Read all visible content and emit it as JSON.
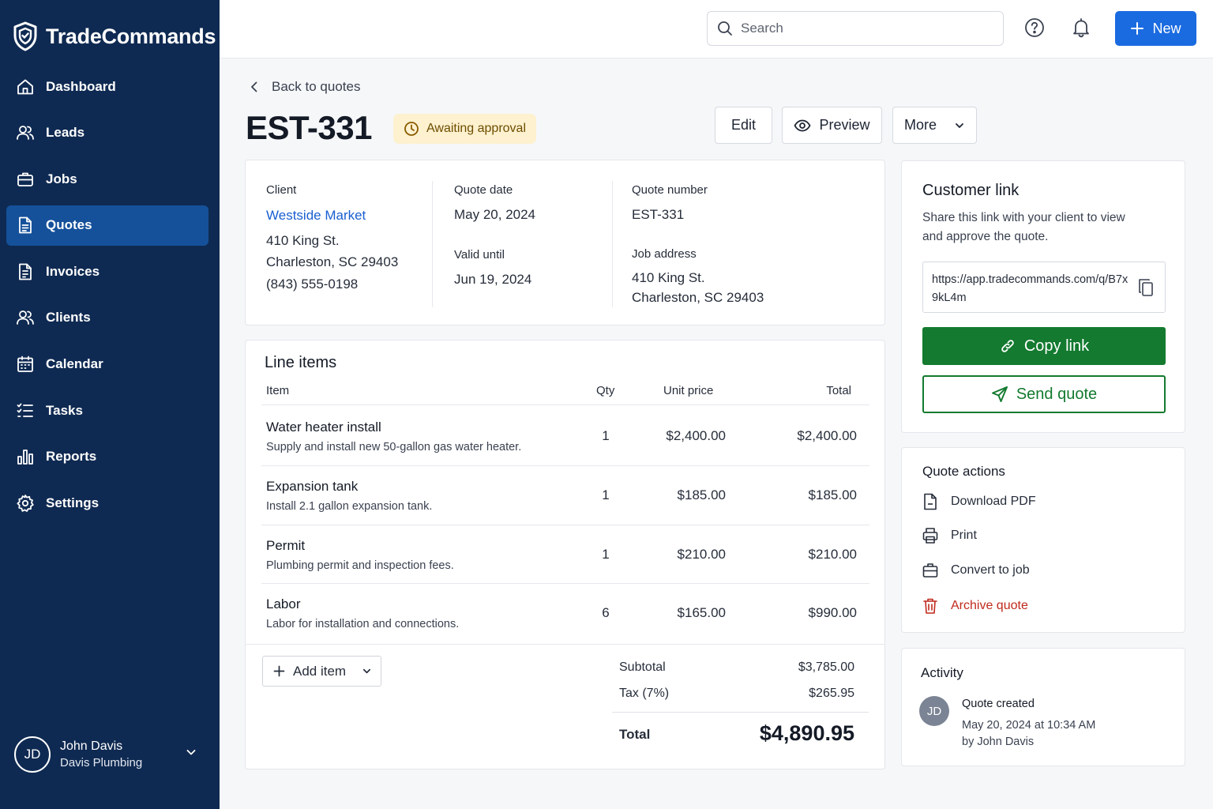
{
  "app": {
    "name": "TradeCommands"
  },
  "sidebar": {
    "items": [
      {
        "label": "Dashboard",
        "icon": "home-icon"
      },
      {
        "label": "Leads",
        "icon": "users-icon"
      },
      {
        "label": "Jobs",
        "icon": "briefcase-icon"
      },
      {
        "label": "Quotes",
        "icon": "document-icon",
        "active": true
      },
      {
        "label": "Invoices",
        "icon": "invoice-icon"
      },
      {
        "label": "Clients",
        "icon": "users-icon"
      },
      {
        "label": "Calendar",
        "icon": "calendar-icon"
      },
      {
        "label": "Tasks",
        "icon": "list-icon"
      },
      {
        "label": "Reports",
        "icon": "bar-chart-icon"
      },
      {
        "label": "Settings",
        "icon": "gear-icon"
      }
    ],
    "user": {
      "initials": "JD",
      "name": "John Davis",
      "company": "Davis Plumbing"
    }
  },
  "topbar": {
    "search_placeholder": "Search",
    "new_label": "New"
  },
  "header": {
    "back_label": "Back to quotes",
    "quote_id": "EST-331",
    "status": "Awaiting approval",
    "edit_label": "Edit",
    "preview_label": "Preview",
    "more_label": "More"
  },
  "details": {
    "client_label": "Client",
    "client_name": "Westside Market",
    "client_street": "410 King St.",
    "client_city": "Charleston, SC 29403",
    "client_phone": "(843) 555-0198",
    "quote_date_label": "Quote date",
    "quote_date": "May 20, 2024",
    "valid_until_label": "Valid until",
    "valid_until": "Jun 19, 2024",
    "quote_number_label": "Quote number",
    "quote_number": "EST-331",
    "job_address_label": "Job address",
    "job_street": "410 King St.",
    "job_city": "Charleston, SC 29403"
  },
  "line_items": {
    "title": "Line items",
    "headers": {
      "item": "Item",
      "qty": "Qty",
      "unit": "Unit price",
      "total": "Total"
    },
    "rows": [
      {
        "name": "Water heater install",
        "desc": "Supply and install new 50-gallon gas water heater.",
        "qty": "1",
        "unit": "$2,400.00",
        "total": "$2,400.00"
      },
      {
        "name": "Expansion tank",
        "desc": "Install 2.1 gallon expansion tank.",
        "qty": "1",
        "unit": "$185.00",
        "total": "$185.00"
      },
      {
        "name": "Permit",
        "desc": "Plumbing permit and inspection fees.",
        "qty": "1",
        "unit": "$210.00",
        "total": "$210.00"
      },
      {
        "name": "Labor",
        "desc": "Labor for installation and connections.",
        "qty": "6",
        "unit": "$165.00",
        "total": "$990.00"
      }
    ],
    "add_item_label": "Add item",
    "subtotal_label": "Subtotal",
    "subtotal": "$3,785.00",
    "tax_label": "Tax (7%)",
    "tax": "$265.95",
    "total_label": "Total",
    "total": "$4,890.95"
  },
  "customer_link": {
    "title": "Customer link",
    "description": "Share this link with your client to view and approve the quote.",
    "url": "https://app.tradecommands.com/q/B7x9kL4m",
    "copy_label": "Copy link",
    "send_label": "Send quote"
  },
  "quote_actions": {
    "title": "Quote actions",
    "items": [
      "Download PDF",
      "Print",
      "Convert to job",
      "Archive quote"
    ]
  },
  "activity": {
    "title": "Activity",
    "initials": "JD",
    "event": "Quote created",
    "time": "May 20, 2024 at 10:34 AM",
    "by": "by John Davis"
  },
  "colors": {
    "sidebar": "#0f2a52",
    "active": "#15519a",
    "primary": "#1a6be0",
    "success": "#137a2f",
    "danger": "#c0291c",
    "warning_bg": "#fdf1cf"
  }
}
